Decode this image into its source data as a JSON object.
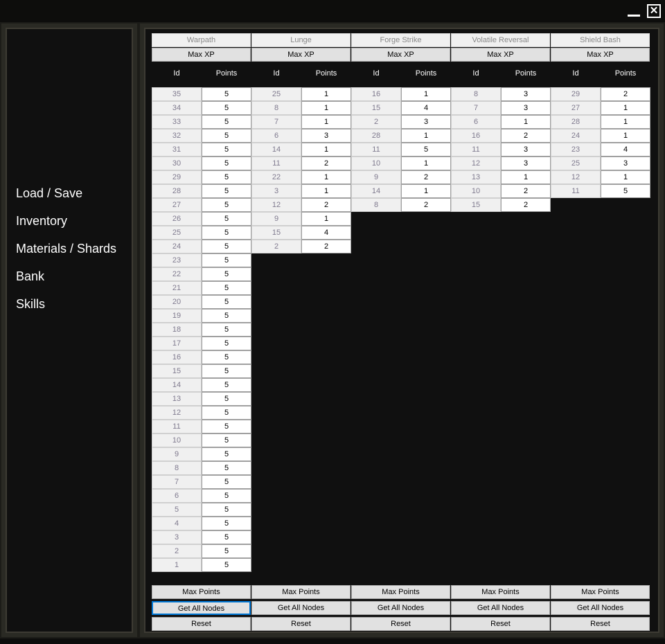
{
  "window": {
    "minimize": "_",
    "close": "✕"
  },
  "nav": [
    "Load / Save",
    "Inventory",
    "Materials / Shards",
    "Bank",
    "Skills"
  ],
  "headers": {
    "id": "Id",
    "points": "Points"
  },
  "buttons": {
    "max_xp": "Max XP",
    "max_points": "Max Points",
    "get_all_nodes": "Get All Nodes",
    "reset": "Reset"
  },
  "skills": [
    {
      "name": "Warpath",
      "rows": [
        [
          35,
          5
        ],
        [
          34,
          5
        ],
        [
          33,
          5
        ],
        [
          32,
          5
        ],
        [
          31,
          5
        ],
        [
          30,
          5
        ],
        [
          29,
          5
        ],
        [
          28,
          5
        ],
        [
          27,
          5
        ],
        [
          26,
          5
        ],
        [
          25,
          5
        ],
        [
          24,
          5
        ],
        [
          23,
          5
        ],
        [
          22,
          5
        ],
        [
          21,
          5
        ],
        [
          20,
          5
        ],
        [
          19,
          5
        ],
        [
          18,
          5
        ],
        [
          17,
          5
        ],
        [
          16,
          5
        ],
        [
          15,
          5
        ],
        [
          14,
          5
        ],
        [
          13,
          5
        ],
        [
          12,
          5
        ],
        [
          11,
          5
        ],
        [
          10,
          5
        ],
        [
          9,
          5
        ],
        [
          8,
          5
        ],
        [
          7,
          5
        ],
        [
          6,
          5
        ],
        [
          5,
          5
        ],
        [
          4,
          5
        ],
        [
          3,
          5
        ],
        [
          2,
          5
        ],
        [
          1,
          5
        ]
      ]
    },
    {
      "name": "Lunge",
      "rows": [
        [
          25,
          1
        ],
        [
          8,
          1
        ],
        [
          7,
          1
        ],
        [
          6,
          3
        ],
        [
          14,
          1
        ],
        [
          11,
          2
        ],
        [
          22,
          1
        ],
        [
          3,
          1
        ],
        [
          12,
          2
        ],
        [
          9,
          1
        ],
        [
          15,
          4
        ],
        [
          2,
          2
        ]
      ]
    },
    {
      "name": "Forge Strike",
      "rows": [
        [
          16,
          1
        ],
        [
          15,
          4
        ],
        [
          2,
          3
        ],
        [
          28,
          1
        ],
        [
          11,
          5
        ],
        [
          10,
          1
        ],
        [
          9,
          2
        ],
        [
          14,
          1
        ],
        [
          8,
          2
        ]
      ]
    },
    {
      "name": "Volatile Reversal",
      "rows": [
        [
          8,
          3
        ],
        [
          7,
          3
        ],
        [
          6,
          1
        ],
        [
          16,
          2
        ],
        [
          11,
          3
        ],
        [
          12,
          3
        ],
        [
          13,
          1
        ],
        [
          10,
          2
        ],
        [
          15,
          2
        ]
      ]
    },
    {
      "name": "Shield Bash",
      "rows": [
        [
          29,
          2
        ],
        [
          27,
          1
        ],
        [
          28,
          1
        ],
        [
          24,
          1
        ],
        [
          23,
          4
        ],
        [
          25,
          3
        ],
        [
          12,
          1
        ],
        [
          11,
          5
        ]
      ]
    }
  ]
}
